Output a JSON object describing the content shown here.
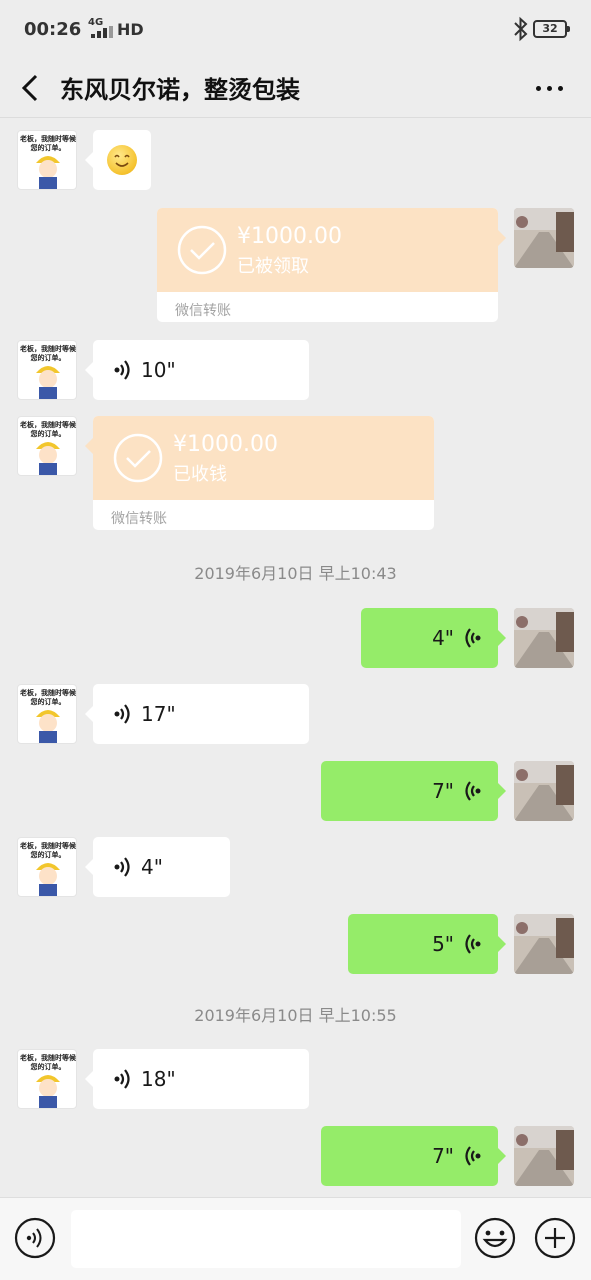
{
  "status_bar": {
    "time": "00:26",
    "network": "4G",
    "hd": "HD",
    "battery": "32"
  },
  "header": {
    "title": "东风贝尔诺，整烫包装",
    "back_icon": "chevron-left-icon",
    "more_icon": "more-dots-icon"
  },
  "avatars": {
    "contact_caption": "老板，我随时等候您的订单。"
  },
  "messages": {
    "emoji": "smiling-face-emoji",
    "transfer_out": {
      "amount": "¥1000.00",
      "status": "已被领取",
      "label": "微信转账"
    },
    "voice_in_1": "10\"",
    "transfer_in": {
      "amount": "¥1000.00",
      "status": "已收钱",
      "label": "微信转账"
    },
    "timestamp_1": "2019年6月10日 早上10:43",
    "voice_out_1": "4\"",
    "voice_in_2": "17\"",
    "voice_out_2": "7\"",
    "voice_in_3": "4\"",
    "voice_out_3": "5\"",
    "timestamp_2": "2019年6月10日 早上10:55",
    "voice_in_4": "18\"",
    "voice_out_4": "7\""
  },
  "input_bar": {
    "placeholder": "",
    "voice_icon": "voice-mode-icon",
    "emoji_icon": "emoji-icon",
    "plus_icon": "plus-icon"
  },
  "colors": {
    "chat_bg": "#ededed",
    "out_bubble": "#95ec69",
    "in_bubble": "#ffffff",
    "transfer_bg": "#fce2c4"
  }
}
